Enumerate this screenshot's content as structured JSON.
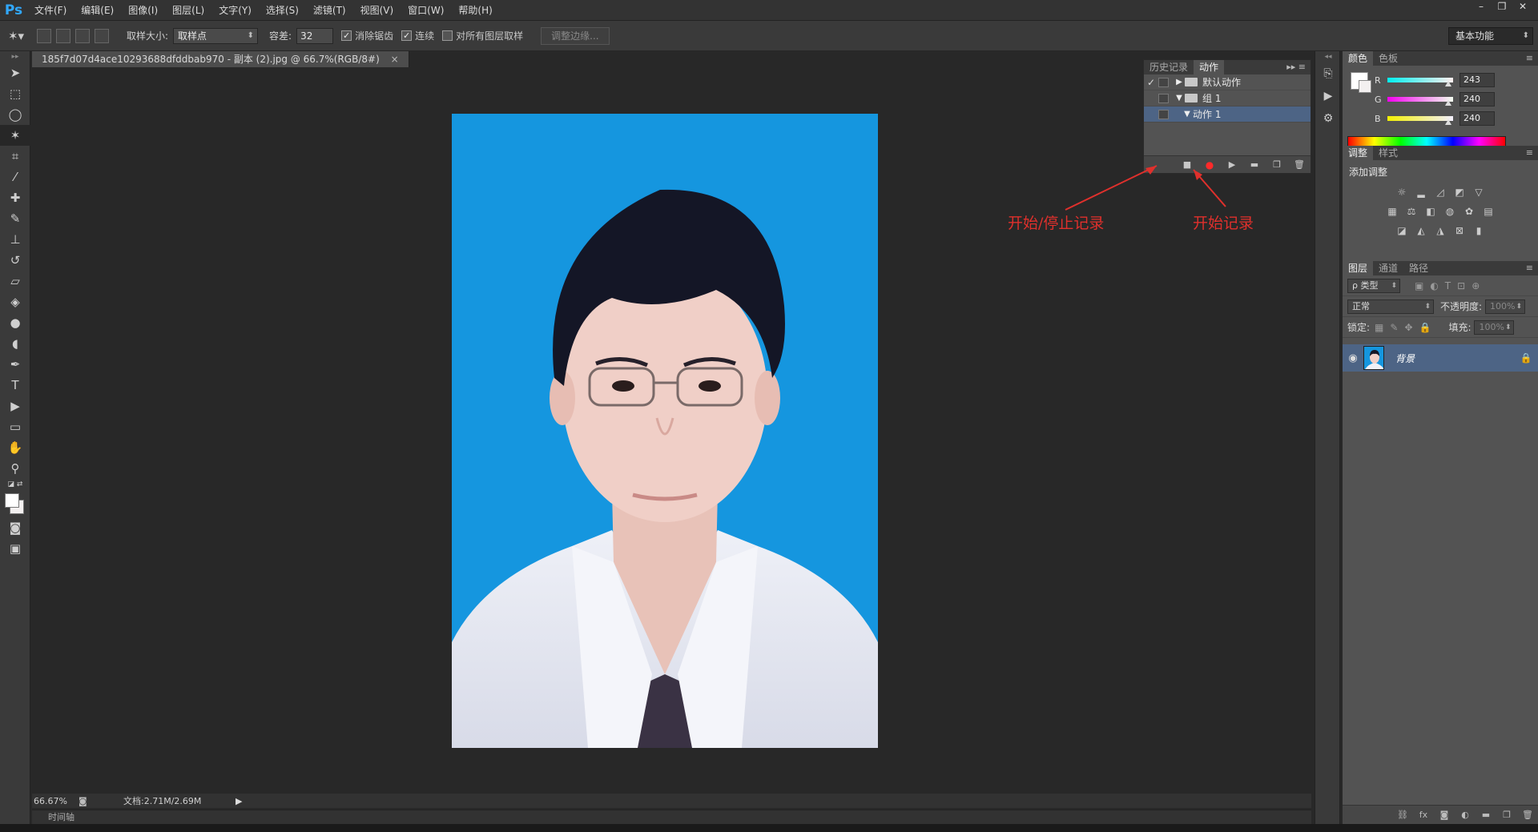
{
  "app": {
    "logo": "Ps"
  },
  "menu": [
    "文件(F)",
    "编辑(E)",
    "图像(I)",
    "图层(L)",
    "文字(Y)",
    "选择(S)",
    "滤镜(T)",
    "视图(V)",
    "窗口(W)",
    "帮助(H)"
  ],
  "window_controls": [
    "–",
    "❐",
    "✕"
  ],
  "options": {
    "sample_size_label": "取样大小:",
    "sample_size_value": "取样点",
    "tolerance_label": "容差:",
    "tolerance_value": "32",
    "antialias_label": "消除锯齿",
    "contiguous_label": "连续",
    "sample_all_label": "对所有图层取样",
    "refine_edge_label": "调整边缘...",
    "workspace": "基本功能"
  },
  "document": {
    "tab_title": "185f7d07d4ace10293688dfddbab970 - 副本 (2).jpg @ 66.7%(RGB/8#)",
    "close": "×",
    "zoom": "66.67%",
    "doc_info": "文档:2.71M/2.69M",
    "timeline_label": "时间轴"
  },
  "actions_panel": {
    "tabs": [
      "历史记录",
      "动作"
    ],
    "rows": [
      {
        "label": "默认动作",
        "checked": "✓"
      },
      {
        "label": "组 1",
        "checked": ""
      },
      {
        "label": "动作 1",
        "checked": ""
      }
    ]
  },
  "annotations": {
    "start_stop": "开始/停止记录",
    "start": "开始记录"
  },
  "color_panel": {
    "tabs": [
      "颜色",
      "色板"
    ],
    "r_label": "R",
    "r_value": "243",
    "g_label": "G",
    "g_value": "240",
    "b_label": "B",
    "b_value": "240"
  },
  "adjustments_panel": {
    "tabs": [
      "调整",
      "样式"
    ],
    "title": "添加调整"
  },
  "layers_panel": {
    "tabs": [
      "图层",
      "通道",
      "路径"
    ],
    "filter": "ρ 类型",
    "blend_mode": "正常",
    "opacity_label": "不透明度:",
    "opacity_value": "100%",
    "lock_label": "锁定:",
    "fill_label": "填充:",
    "fill_value": "100%",
    "layer_name": "背景"
  },
  "colors": {
    "accent": "#31a8ff",
    "photo_bg": "#1596df",
    "annotation": "#e0302c",
    "selection": "#4d6485"
  }
}
